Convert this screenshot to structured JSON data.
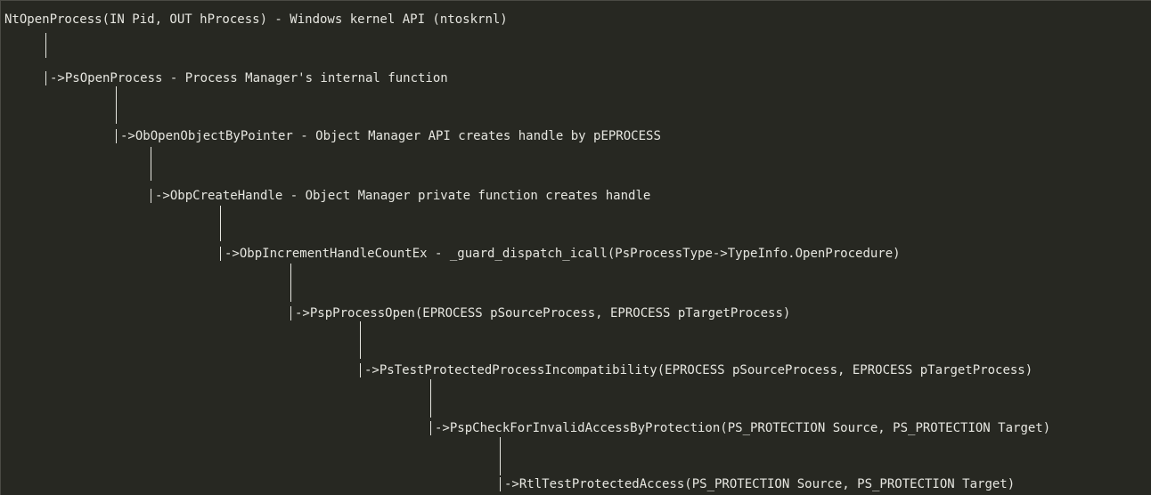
{
  "lines": [
    "NtOpenProcess(IN Pid, OUT hProcess) - Windows kernel API (ntoskrnl)",
    "->PsOpenProcess - Process Manager's internal function",
    "->ObOpenObjectByPointer - Object Manager API creates handle by pEPROCESS",
    "->ObpCreateHandle - Object Manager private function creates handle",
    "->ObpIncrementHandleCountEx - _guard_dispatch_icall(PsProcessType->TypeInfo.OpenProcedure)",
    "->PspProcessOpen(EPROCESS pSourceProcess, EPROCESS pTargetProcess)",
    "->PsTestProtectedProcessIncompatibility(EPROCESS pSourceProcess, EPROCESS pTargetProcess)",
    "->PspCheckForInvalidAccessByProtection(PS_PROTECTION Source, PS_PROTECTION Target)",
    "->RtlTestProtectedAccess(PS_PROTECTION Source, PS_PROTECTION Target)"
  ]
}
